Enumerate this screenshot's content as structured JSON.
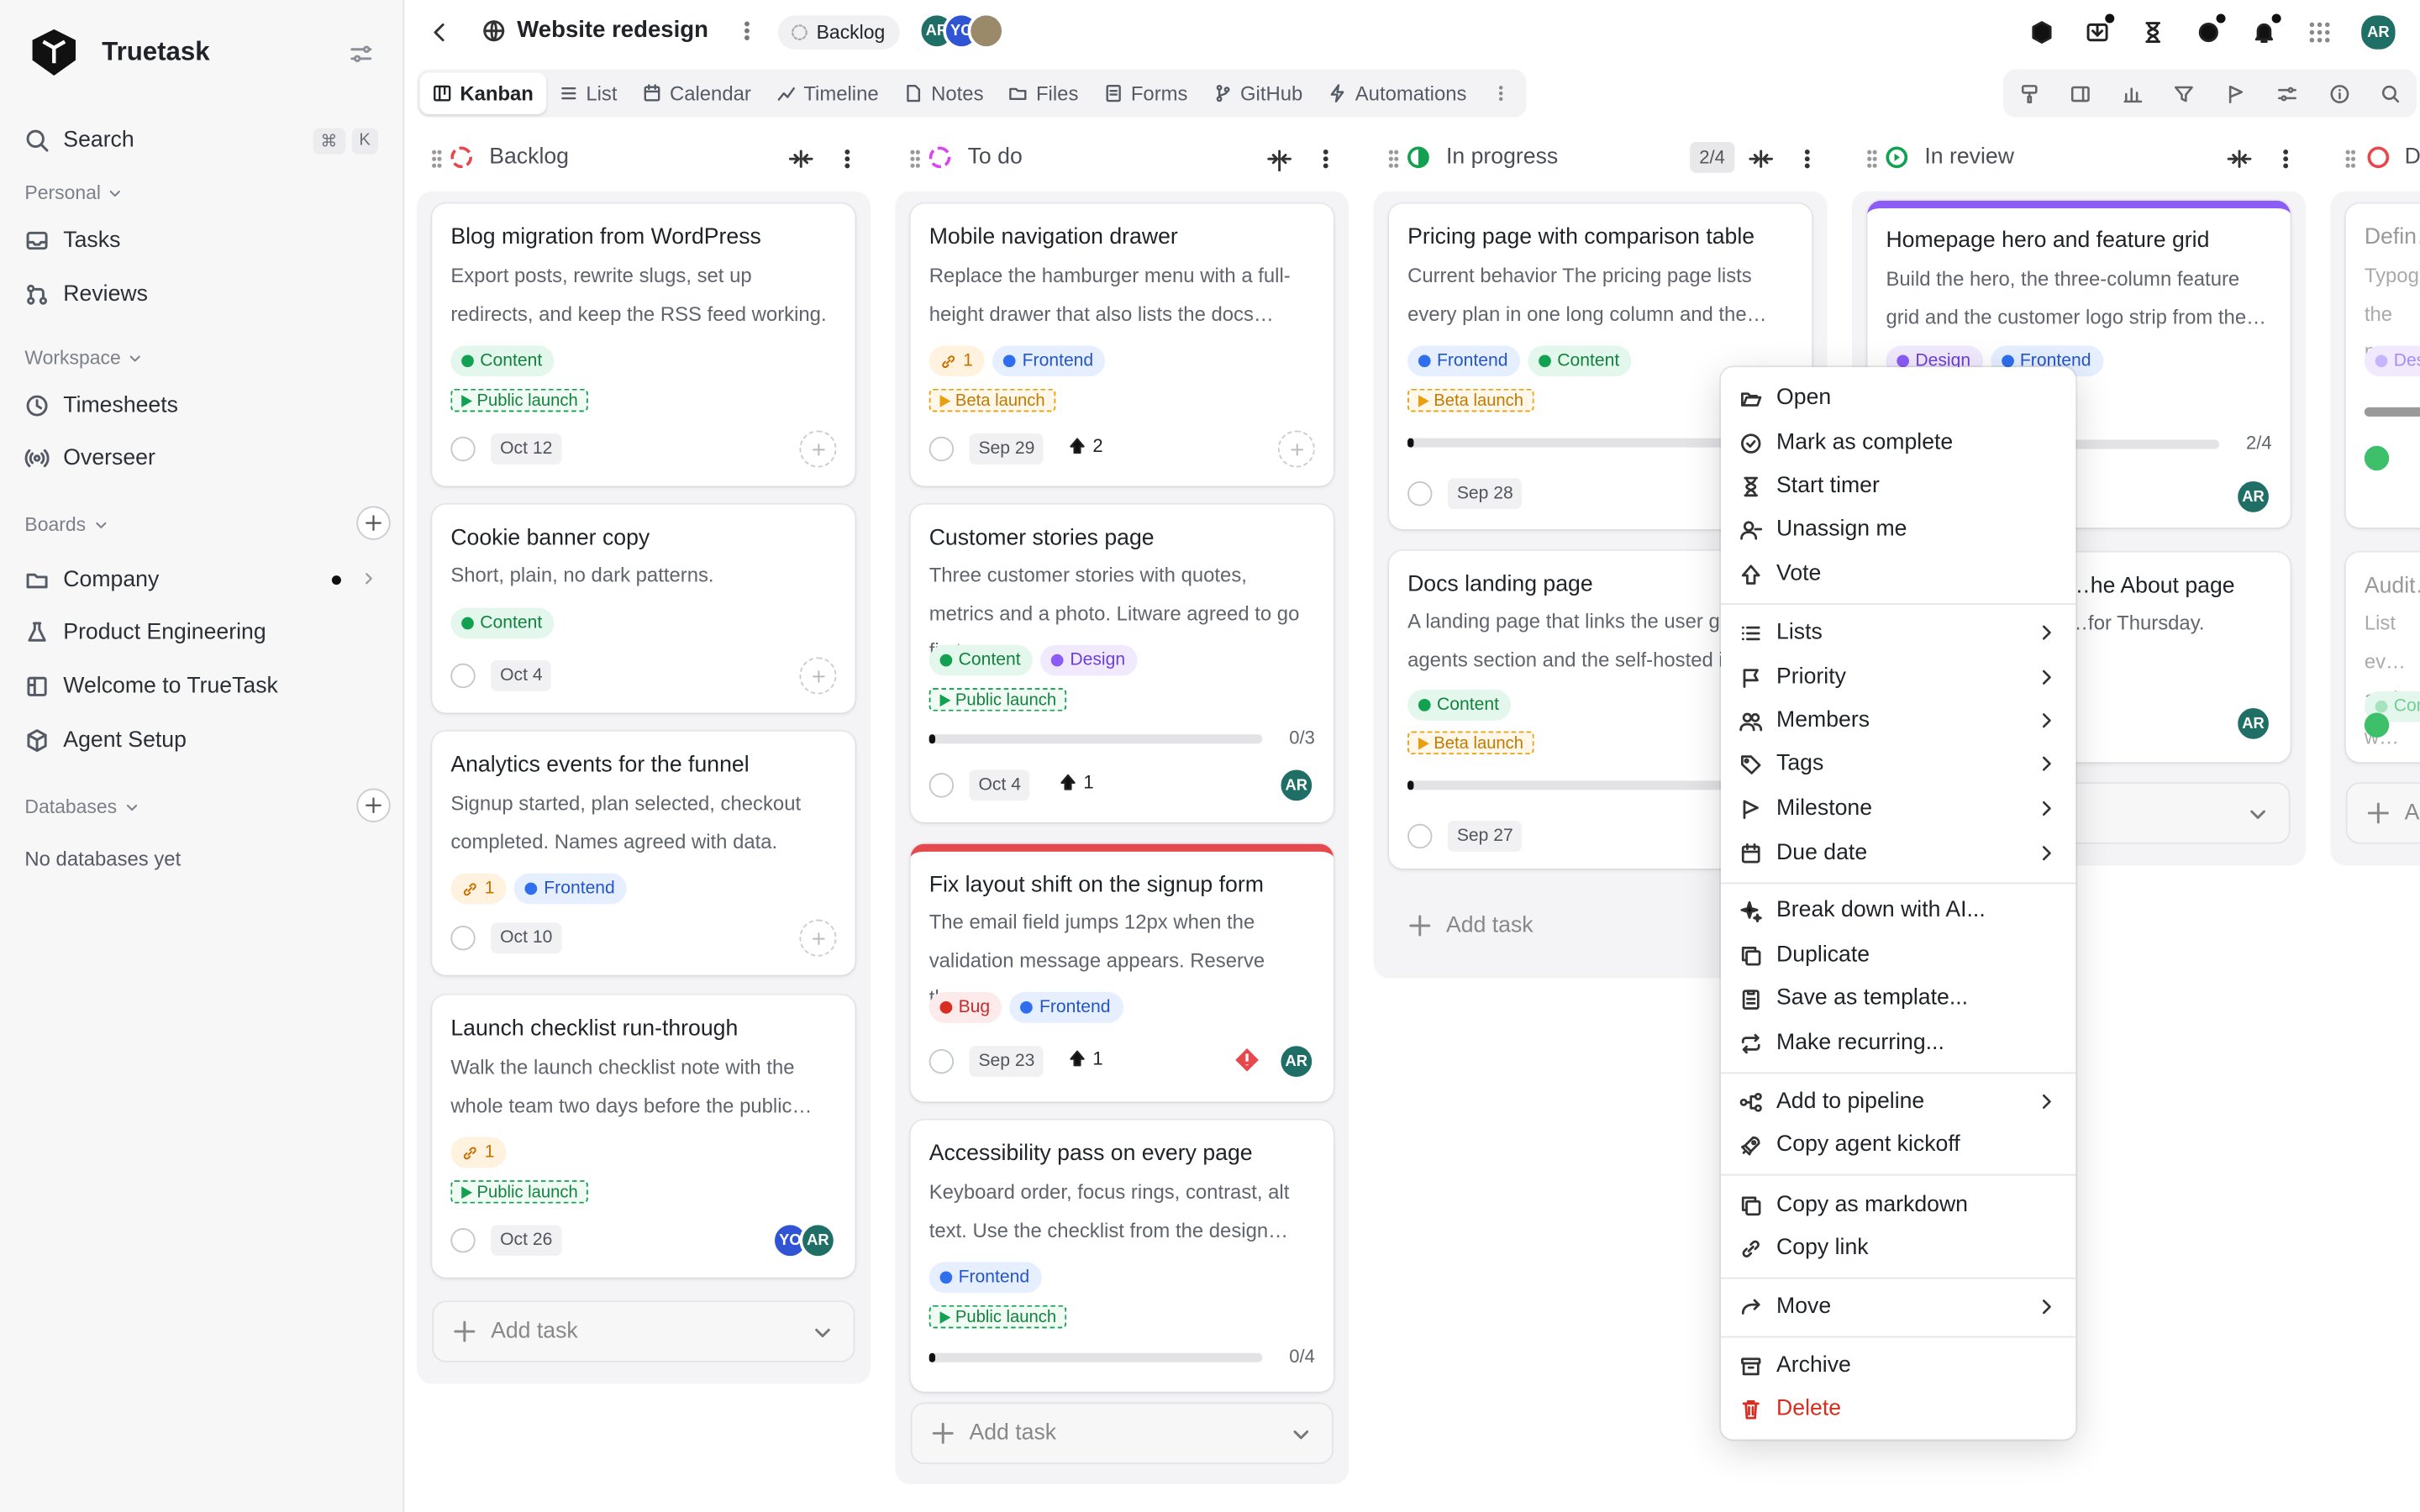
{
  "app": {
    "name": "Truetask"
  },
  "sidebar": {
    "search": "Search",
    "kbd": [
      "⌘",
      "K"
    ],
    "personal": "Personal",
    "tasks": "Tasks",
    "reviews": "Reviews",
    "workspace": "Workspace",
    "timesheets": "Timesheets",
    "overseer": "Overseer",
    "boards": "Boards",
    "board_items": [
      "Company",
      "Product Engineering",
      "Welcome to TrueTask",
      "Agent Setup"
    ],
    "databases": "Databases",
    "no_db": "No databases yet"
  },
  "header": {
    "title": "Website redesign",
    "status": "Backlog",
    "avatars": [
      "AR",
      "YO"
    ],
    "user": "AR"
  },
  "tabs": [
    "Kanban",
    "List",
    "Calendar",
    "Timeline",
    "Notes",
    "Files",
    "Forms",
    "GitHub",
    "Automations"
  ],
  "colors": {
    "content": "#12a150",
    "frontend": "#2f6fed",
    "design": "#8b5cf6",
    "bug": "#d92d20",
    "milestone_green": "#12a150",
    "milestone_orange": "#e8a010",
    "avatar_ar": "#1f6f66",
    "avatar_yo": "#2f55d4",
    "accent_purple": "#8b5cf6",
    "accent_red": "#e5484d"
  },
  "columns": [
    {
      "title": "Backlog",
      "count": "",
      "cards": [
        {
          "title": "Blog migration from WordPress",
          "desc": "Export posts, rewrite slugs, set up redirects, and keep the RSS feed working.",
          "tags": [
            "Content"
          ],
          "milestone": "Public launch",
          "date": "Oct 12"
        },
        {
          "title": "Cookie banner copy",
          "desc": "Short, plain, no dark patterns.",
          "tags": [
            "Content"
          ],
          "date": "Oct 4"
        },
        {
          "title": "Analytics events for the funnel",
          "desc": "Signup started, plan selected, checkout completed. Names agreed with data.",
          "link": "1",
          "tags": [
            "Frontend"
          ],
          "date": "Oct 10"
        },
        {
          "title": "Launch checklist run-through",
          "desc": "Walk the launch checklist note with the whole team two days before the public…",
          "link": "1",
          "milestone": "Public launch",
          "date": "Oct 26",
          "avatars": [
            "YO",
            "AR"
          ]
        }
      ],
      "add": "Add task"
    },
    {
      "title": "To do",
      "count": "",
      "cards": [
        {
          "title": "Mobile navigation drawer",
          "desc": "Replace the hamburger menu with a full-height drawer that also lists the docs…",
          "link": "1",
          "tags": [
            "Frontend"
          ],
          "milestone": "Beta launch",
          "date": "Sep 29",
          "votes": "2"
        },
        {
          "title": "Customer stories page",
          "desc": "Three customer stories with quotes, metrics and a photo. Litware agreed to go first.",
          "tags": [
            "Content",
            "Design"
          ],
          "milestone": "Public launch",
          "progress": "0/3",
          "progress_value": 0.02,
          "date": "Oct 4",
          "votes": "1",
          "avatars": [
            "AR"
          ]
        },
        {
          "title": "Fix layout shift on the signup form",
          "desc": "The email field jumps 12px when the validation message appears. Reserve the…",
          "tags": [
            "Bug",
            "Frontend"
          ],
          "date": "Sep 23",
          "votes": "1",
          "avatars": [
            "AR"
          ]
        },
        {
          "title": "Accessibility pass on every page",
          "desc": "Keyboard order, focus rings, contrast, alt text. Use the checklist from the design…",
          "tags": [
            "Frontend"
          ],
          "milestone": "Public launch",
          "progress": "0/4",
          "progress_value": 0.02
        }
      ],
      "add": "Add task"
    },
    {
      "title": "In progress",
      "count": "2/4",
      "cards": [
        {
          "title": "Pricing page with comparison table",
          "desc": "Current behavior The pricing page lists every plan in one long column and the…",
          "tags": [
            "Frontend",
            "Content"
          ],
          "milestone": "Beta launch",
          "date": "Sep 28"
        },
        {
          "title": "Docs landing page",
          "desc": "A landing page that links the user guide, the agents section and the self-hosted i…",
          "tags": [
            "Content"
          ],
          "milestone": "Beta launch",
          "date": "Sep 27"
        }
      ],
      "add": "Add task"
    },
    {
      "title": "In review",
      "count": "",
      "cards": [
        {
          "title": "Homepage hero and feature grid",
          "desc": "Build the hero, the three-column feature grid and the customer logo strip from the…",
          "tags": [
            "Design",
            "Frontend"
          ],
          "progress": "2/4",
          "avatars": [
            "AR"
          ]
        },
        {
          "title": "…he About page",
          "desc": "…for Thursday.",
          "avatars": [
            "AR"
          ]
        }
      ]
    },
    {
      "title": "D…",
      "cards": [
        {
          "title": "Defin…",
          "desc": "Typog… the ne…",
          "tags": [
            "Des…"
          ]
        },
        {
          "title": "Audit…",
          "desc": "List ev… and w…",
          "tags": [
            "Con…"
          ]
        }
      ],
      "add": "A…"
    }
  ],
  "menu": {
    "group1": [
      "Open",
      "Mark as complete",
      "Start timer",
      "Unassign me",
      "Vote"
    ],
    "group2": [
      "Lists",
      "Priority",
      "Members",
      "Tags",
      "Milestone",
      "Due date"
    ],
    "group3": [
      "Break down with AI...",
      "Duplicate",
      "Save as template...",
      "Make recurring..."
    ],
    "group4": [
      "Add to pipeline",
      "Copy agent kickoff"
    ],
    "group5": [
      "Copy as markdown",
      "Copy link"
    ],
    "group6": [
      "Move"
    ],
    "group7": [
      "Archive",
      "Delete"
    ]
  }
}
